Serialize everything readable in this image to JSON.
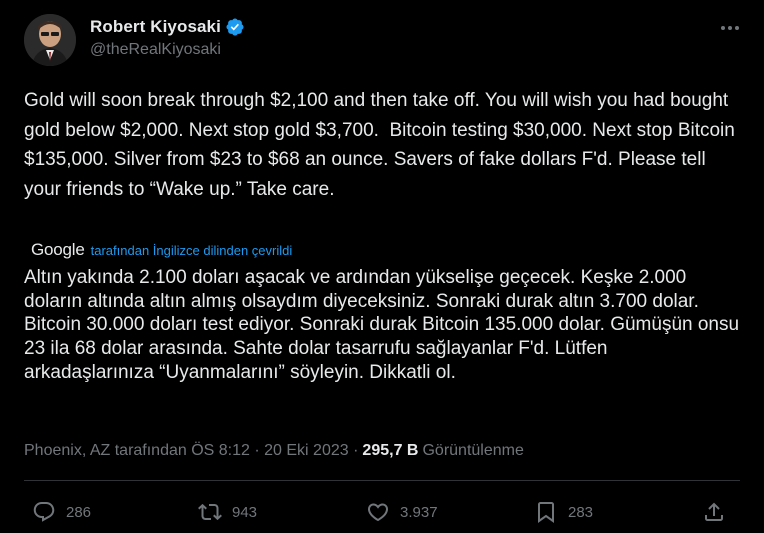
{
  "author": {
    "display_name": "Robert Kiyosaki",
    "handle": "@theRealKiyosaki",
    "verified": true
  },
  "tweet": {
    "text": "Gold will soon break through $2,100 and then take off. You will wish you had bought gold below $2,000. Next stop gold $3,700.  Bitcoin testing $30,000. Next stop Bitcoin $135,000. Silver from $23 to $68 an ounce. Savers of fake dollars F'd. Please tell your friends to “Wake up.” Take care.",
    "translation": {
      "provider_logo": "Google",
      "link_text": "tarafından İngilizce dilinden çevrildi",
      "text": "Altın yakında 2.100 doları aşacak ve ardından yükselişe geçecek. Keşke 2.000 doların altında altın almış olsaydım diyeceksiniz. Sonraki durak altın 3.700 dolar. Bitcoin 30.000 doları test ediyor. Sonraki durak Bitcoin 135.000 dolar. Gümüşün onsu 23 ila 68 dolar arasında. Sahte dolar tasarrufu sağlayanlar F'd. Lütfen arkadaşlarınıza “Uyanmalarını” söyleyin. Dikkatli ol."
    },
    "meta": {
      "source_time": "Phoenix, AZ tarafından ÖS 8:12 · 20 Eki 2023 ·",
      "views_count": "295,7 B",
      "views_label": "Görüntülenme"
    },
    "actions": {
      "replies": "286",
      "reposts": "943",
      "likes": "3.937",
      "bookmarks": "283"
    }
  },
  "colors": {
    "background": "#000000",
    "text": "#e7e9ea",
    "secondary": "#71767b",
    "link": "#1d9bf0",
    "divider": "#2f3336"
  }
}
